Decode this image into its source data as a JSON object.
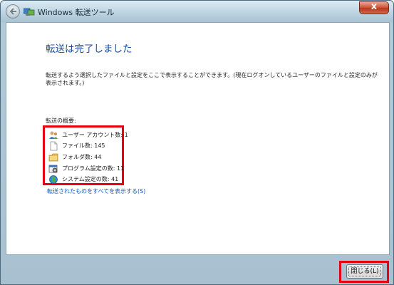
{
  "window": {
    "title": "Windows 転送ツール",
    "close_glyph": "x"
  },
  "main": {
    "heading": "転送は完了しました",
    "description": "転送するよう選択したファイルと設定をここで表示することができます。(現在ログオンしているユーザーのファイルと設定のみが表示されます。)",
    "summary_label": "転送の概要:",
    "summary_items": [
      {
        "label": "ユーザー アカウント数: 1",
        "icon": "users-icon"
      },
      {
        "label": "ファイル数: 145",
        "icon": "file-icon"
      },
      {
        "label": "フォルダ数: 44",
        "icon": "folder-icon"
      },
      {
        "label": "プログラム設定の数: 11",
        "icon": "program-settings-icon"
      },
      {
        "label": "システム設定の数: 41",
        "icon": "globe-icon"
      }
    ],
    "show_all_link": "転送されたものをすべてを表示する(S)"
  },
  "footer": {
    "close_button_label": "閉じる(L)"
  },
  "colors": {
    "heading": "#1e4fa0",
    "link": "#0a58c6",
    "highlight": "#e60012"
  }
}
